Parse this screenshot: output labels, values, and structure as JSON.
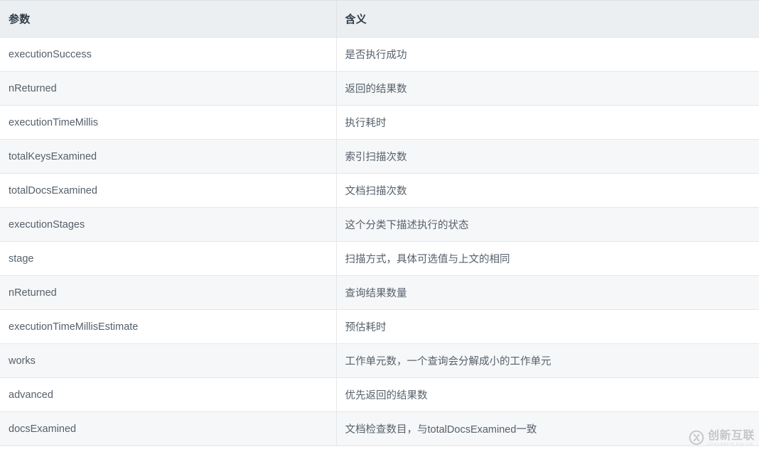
{
  "table": {
    "columns": [
      {
        "key": "param",
        "header": "参数"
      },
      {
        "key": "meaning",
        "header": "含义"
      }
    ],
    "rows": [
      {
        "param": "executionSuccess",
        "meaning": "是否执行成功"
      },
      {
        "param": "nReturned",
        "meaning": "返回的结果数"
      },
      {
        "param": "executionTimeMillis",
        "meaning": "执行耗时"
      },
      {
        "param": "totalKeysExamined",
        "meaning": "索引扫描次数"
      },
      {
        "param": "totalDocsExamined",
        "meaning": "文档扫描次数"
      },
      {
        "param": "executionStages",
        "meaning": "这个分类下描述执行的状态"
      },
      {
        "param": "stage",
        "meaning": "扫描方式，具体可选值与上文的相同"
      },
      {
        "param": "nReturned",
        "meaning": "查询结果数量"
      },
      {
        "param": "executionTimeMillisEstimate",
        "meaning": "预估耗时"
      },
      {
        "param": "works",
        "meaning": "工作单元数，一个查询会分解成小的工作单元"
      },
      {
        "param": "advanced",
        "meaning": "优先返回的结果数"
      },
      {
        "param": "docsExamined",
        "meaning": "文档检查数目，与totalDocsExamined一致"
      }
    ]
  },
  "watermark": {
    "title": "创新互联",
    "subtitle": "CHUANGXIN HULIAN",
    "logo_icon": "circle-x-logo-icon"
  },
  "colors": {
    "header_bg": "#eceff1",
    "row_odd_bg": "#ffffff",
    "row_even_bg": "#f6f7f8",
    "border": "#e4e7ea",
    "header_border": "#dfe2e5",
    "header_text": "#2f3b45",
    "body_text": "#55606b",
    "watermark_text": "#a9a9ac"
  }
}
